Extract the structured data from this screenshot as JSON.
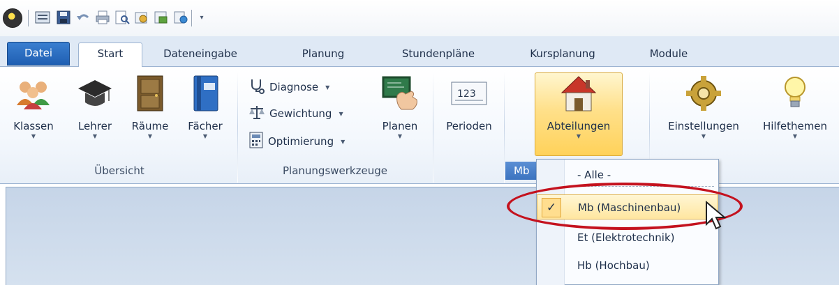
{
  "tabs": {
    "file": "Datei",
    "start": "Start",
    "data_entry": "Dateneingabe",
    "planning": "Planung",
    "timetables": "Stundenpläne",
    "course_planning": "Kursplanung",
    "modules": "Module"
  },
  "ribbon": {
    "overview": {
      "label": "Übersicht",
      "classes": "Klassen",
      "teachers": "Lehrer",
      "rooms": "Räume",
      "subjects": "Fächer"
    },
    "planning_tools": {
      "label": "Planungswerkzeuge",
      "diagnosis": "Diagnose",
      "weighting": "Gewichtung",
      "optimization": "Optimierung",
      "plan": "Planen"
    },
    "periods": "Perioden",
    "departments": {
      "label": "Abteilungen",
      "group_label": "Mb"
    },
    "settings": "Einstellungen",
    "help_topics": "Hilfethemen"
  },
  "dropdown": {
    "items": [
      {
        "label": "- Alle -",
        "selected": false
      },
      {
        "label": "Mb (Maschinenbau)",
        "selected": true
      },
      {
        "label": "Et (Elektrotechnik)",
        "selected": false
      },
      {
        "label": "Hb (Hochbau)",
        "selected": false
      }
    ],
    "check_glyph": "✓"
  },
  "colors": {
    "highlight": "#ffd25a",
    "annotation": "#c4121e",
    "file_tab": "#2a6ec4"
  }
}
